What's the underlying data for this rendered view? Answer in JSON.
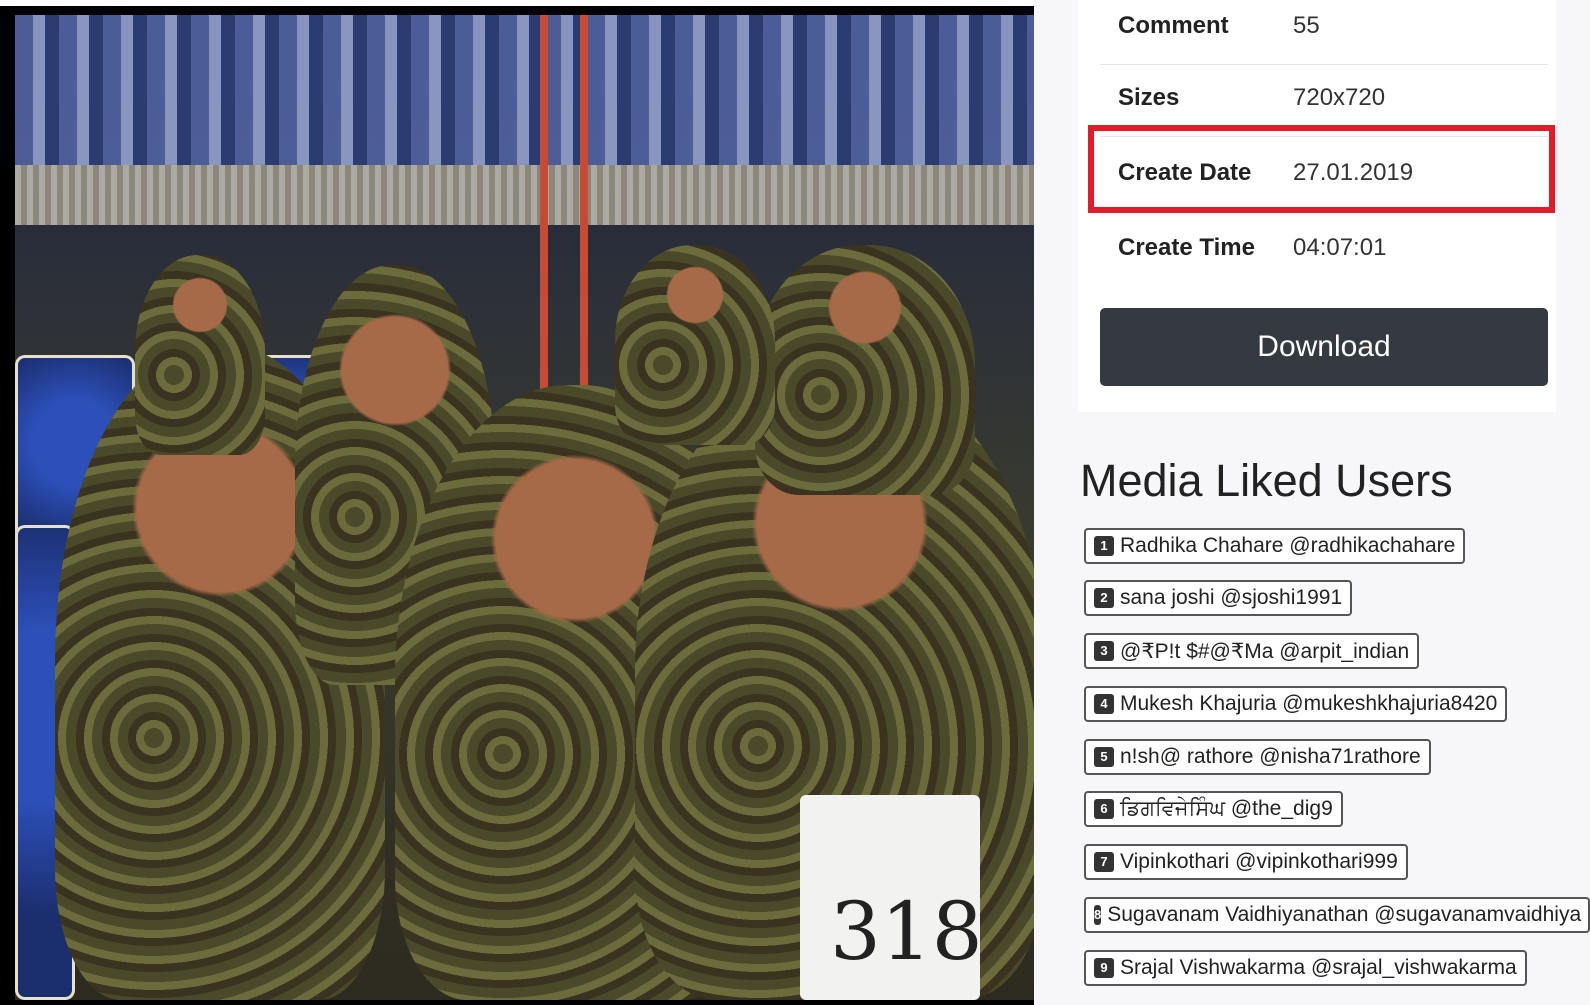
{
  "photo": {
    "tag_text": "318"
  },
  "details": {
    "rows": [
      {
        "key": "Comment",
        "value": "55"
      },
      {
        "key": "Sizes",
        "value": "720x720"
      },
      {
        "key": "Create Date",
        "value": "27.01.2019"
      },
      {
        "key": "Create Time",
        "value": "04:07:01"
      }
    ],
    "download_label": "Download"
  },
  "liked": {
    "title": "Media Liked Users",
    "users": [
      {
        "num": "1",
        "text": "Radhika Chahare @radhikachahare"
      },
      {
        "num": "2",
        "text": "sana joshi @sjoshi1991"
      },
      {
        "num": "3",
        "text": "@₹P!t $#@₹Ma @arpit_indian"
      },
      {
        "num": "4",
        "text": "Mukesh Khajuria @mukeshkhajuria8420"
      },
      {
        "num": "5",
        "text": "n!sh@ rathore @nisha71rathore"
      },
      {
        "num": "6",
        "text": "ਡਿਗਵਿਜੇਸਿੰਘ @the_dig9"
      },
      {
        "num": "7",
        "text": "Vipinkothari @vipinkothari999"
      },
      {
        "num": "8",
        "text": "Sugavanam Vaidhiyanathan @sugavanamvaidhiya"
      },
      {
        "num": "9",
        "text": "Srajal Vishwakarma @srajal_vishwakarma"
      }
    ]
  },
  "colors": {
    "highlight": "#e21b2b",
    "button": "#343a40"
  }
}
